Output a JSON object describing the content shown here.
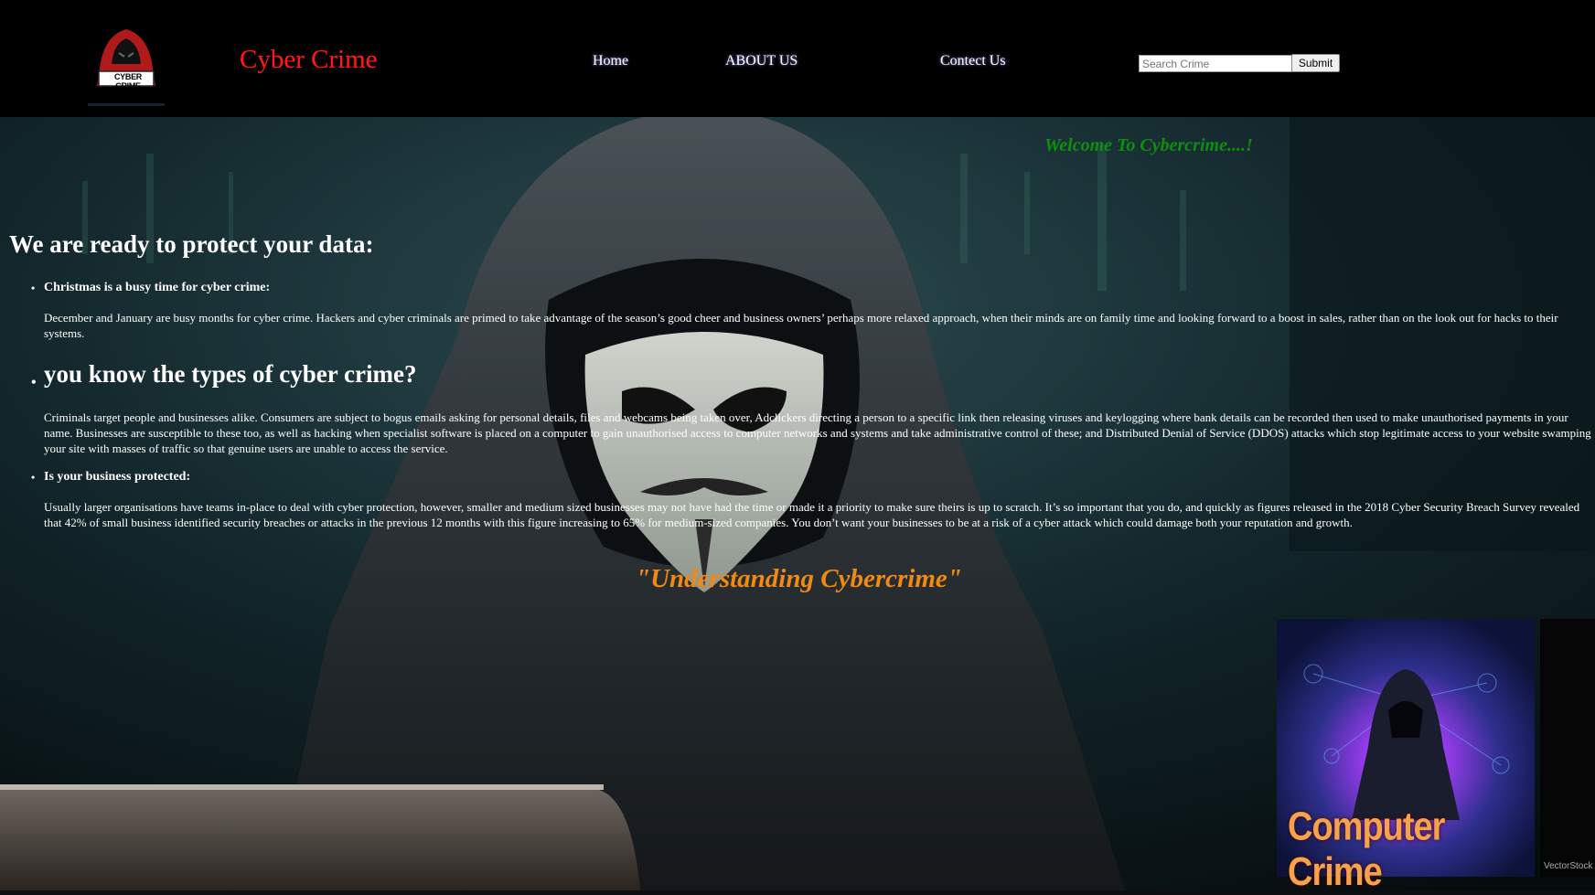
{
  "header": {
    "brand": "Cyber Crime",
    "logo_text": "CYBER CRIME",
    "nav": [
      {
        "label": "Home"
      },
      {
        "label": "ABOUT US"
      },
      {
        "label": "Contect Us"
      }
    ],
    "search": {
      "placeholder": "Search Crime",
      "value": ""
    },
    "submit_label": "Submit"
  },
  "welcome": "Welcome To Cybercrime....!",
  "content": {
    "heading": "We are ready to protect your data:",
    "items": [
      {
        "title": "Christmas is a busy time for cyber crime:",
        "text": "December and January are busy months for cyber crime. Hackers and cyber criminals are primed to take advantage of the season’s good cheer and business owners’ perhaps more relaxed approach, when their minds are on family time and looking forward to a boost in sales, rather than on the look out for hacks to their systems."
      },
      {
        "title": "you know the types of cyber crime?",
        "text": "Criminals target people and businesses alike. Consumers are subject to bogus emails asking for personal details, files and webcams being taken over, Adclickers directing a person to a specific link then releasing viruses and keylogging where bank details can be recorded then used to make unauthorised payments in your name. Businesses are susceptible to these too, as well as hacking when specialist software is placed on a computer to gain unauthorised access to computer networks and systems and take administrative control of these; and Distributed Denial of Service (DDOS) attacks which stop legitimate access to your website swamping your site with masses of traffic so that genuine users are unable to access the service."
      },
      {
        "title": "Is your business protected:",
        "text": "Usually larger organisations have teams in-place to deal with cyber protection, however, smaller and medium sized businesses may not have had the time or made it a priority to make sure theirs is up to scratch. It’s so important that you do, and quickly as figures released in the 2018 Cyber Security Breach Survey revealed that 42% of small business identified security breaches or attacks in the previous 12 months with this figure increasing to 65% for medium-sized companies. You don’t want your businesses to be at a risk of a cyber attack which could damage both your reputation and growth."
      }
    ]
  },
  "quote": "\"Understanding Cybercrime\"",
  "thumbnail": {
    "caption": "Computer Crime",
    "watermark": "VectorStock"
  },
  "colors": {
    "brand": "#ff1a1a",
    "welcome": "#0f8f0f",
    "quote": "#f08a12",
    "header_bg": "#000000"
  }
}
